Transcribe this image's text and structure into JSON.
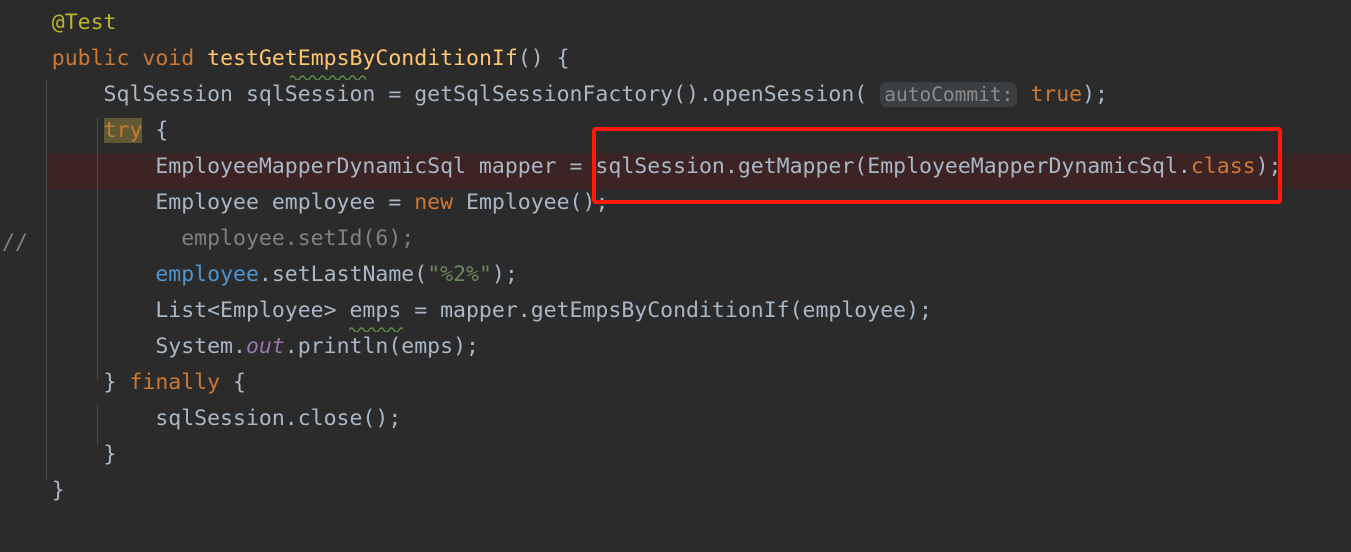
{
  "editor": {
    "background": "#2B2B2B",
    "foreground": "#A9B7C6",
    "font_size_px": 21.5,
    "line_height_px": 36,
    "colors": {
      "keyword": "#CC7832",
      "annotation": "#BBB529",
      "method_declaration": "#FFC66D",
      "string": "#6A8759",
      "field": "#4E94CE",
      "static_field": "#9876AA",
      "comment": "#808080",
      "param_hint_bg": "#3C3F41",
      "param_hint_fg": "#8C8C8C",
      "search_highlight_bg": "#5F5A33",
      "current_line_bg": "#3C2424",
      "indent_guide": "#4B4B4B",
      "annotation_box": "#FF1A0D",
      "weak_warning_underline": "#5E8C4A"
    }
  },
  "gutter": {
    "comment_marker": "//"
  },
  "annotation_box": {
    "label": "sqlSession.getMapper(EmployeeMapperDynamicSql.class)",
    "color": "#FF1A0D"
  },
  "code": {
    "lines": [
      {
        "id": "line-test-annotation",
        "plain": "    @Test",
        "tokens": [
          {
            "text": "    ",
            "cls": "t-default"
          },
          {
            "text": "@Test",
            "cls": "t-annot"
          }
        ]
      },
      {
        "id": "line-method-signature",
        "plain": "    public void testGetEmpsByConditionIf() {",
        "tokens": [
          {
            "text": "    ",
            "cls": "t-default"
          },
          {
            "text": "public",
            "cls": "t-keyword"
          },
          {
            "text": " ",
            "cls": "t-default"
          },
          {
            "text": "void",
            "cls": "t-keyword"
          },
          {
            "text": " ",
            "cls": "t-default"
          },
          {
            "text": "testGetEmpsByConditionIf",
            "cls": "t-method"
          },
          {
            "text": "() {",
            "cls": "t-default"
          }
        ]
      },
      {
        "id": "line-sqlsession-open",
        "plain": "        SqlSession sqlSession = getSqlSessionFactory().openSession( autoCommit: true);",
        "tokens": [
          {
            "text": "        SqlSession sqlSession = getSqlSessionFactory().openSession(",
            "cls": "t-default"
          },
          {
            "text": " ",
            "cls": "t-default"
          },
          {
            "text": "autoCommit:",
            "cls": "param-hint"
          },
          {
            "text": " ",
            "cls": "t-default"
          },
          {
            "text": "true",
            "cls": "t-keyword"
          },
          {
            "text": ");",
            "cls": "t-default"
          }
        ]
      },
      {
        "id": "line-try",
        "plain": "        try {",
        "tokens": [
          {
            "text": "        ",
            "cls": "t-default"
          },
          {
            "text": "try",
            "cls": "hl-try"
          },
          {
            "text": " {",
            "cls": "t-default"
          }
        ]
      },
      {
        "id": "line-get-mapper",
        "plain": "            EmployeeMapperDynamicSql mapper = sqlSession.getMapper(EmployeeMapperDynamicSql.class);",
        "tokens": [
          {
            "text": "            EmployeeMapperDynamicSql mapper = sqlSession.getMapper(EmployeeMapperDynamicSql.",
            "cls": "t-default"
          },
          {
            "text": "class",
            "cls": "t-keyword"
          },
          {
            "text": ");",
            "cls": "t-default"
          }
        ]
      },
      {
        "id": "line-new-employee",
        "plain": "            Employee employee = new Employee();",
        "tokens": [
          {
            "text": "            Employee employee = ",
            "cls": "t-default"
          },
          {
            "text": "new",
            "cls": "t-keyword"
          },
          {
            "text": " Employee();",
            "cls": "t-default"
          }
        ]
      },
      {
        "id": "line-set-id-commented",
        "plain": "              employee.setId(6);",
        "tokens": [
          {
            "text": "              employee.setId(6);",
            "cls": "t-comment"
          }
        ]
      },
      {
        "id": "line-set-lastname",
        "plain": "            employee.setLastName(\"%2%\");",
        "tokens": [
          {
            "text": "            ",
            "cls": "t-default"
          },
          {
            "text": "employee",
            "cls": "t-field"
          },
          {
            "text": ".setLastName(",
            "cls": "t-default"
          },
          {
            "text": "\"%2%\"",
            "cls": "t-string"
          },
          {
            "text": ");",
            "cls": "t-default"
          }
        ]
      },
      {
        "id": "line-get-emps",
        "plain": "            List<Employee> emps = mapper.getEmpsByConditionIf(employee);",
        "tokens": [
          {
            "text": "            List<Employee> emps = mapper.getEmpsByConditionIf(employee);",
            "cls": "t-default"
          }
        ]
      },
      {
        "id": "line-println",
        "plain": "            System.out.println(emps);",
        "tokens": [
          {
            "text": "            System.",
            "cls": "t-default"
          },
          {
            "text": "out",
            "cls": "t-static"
          },
          {
            "text": ".println(emps);",
            "cls": "t-default"
          }
        ]
      },
      {
        "id": "line-finally",
        "plain": "        } finally {",
        "tokens": [
          {
            "text": "        } ",
            "cls": "t-default"
          },
          {
            "text": "finally",
            "cls": "t-keyword"
          },
          {
            "text": " {",
            "cls": "t-default"
          }
        ]
      },
      {
        "id": "line-close",
        "plain": "            sqlSession.close();",
        "tokens": [
          {
            "text": "            sqlSession.close();",
            "cls": "t-default"
          }
        ]
      },
      {
        "id": "line-close-try-brace",
        "plain": "        }",
        "tokens": [
          {
            "text": "        }",
            "cls": "t-default"
          }
        ]
      },
      {
        "id": "line-close-method-brace",
        "plain": "    }",
        "tokens": [
          {
            "text": "    }",
            "cls": "t-default"
          }
        ]
      }
    ]
  }
}
